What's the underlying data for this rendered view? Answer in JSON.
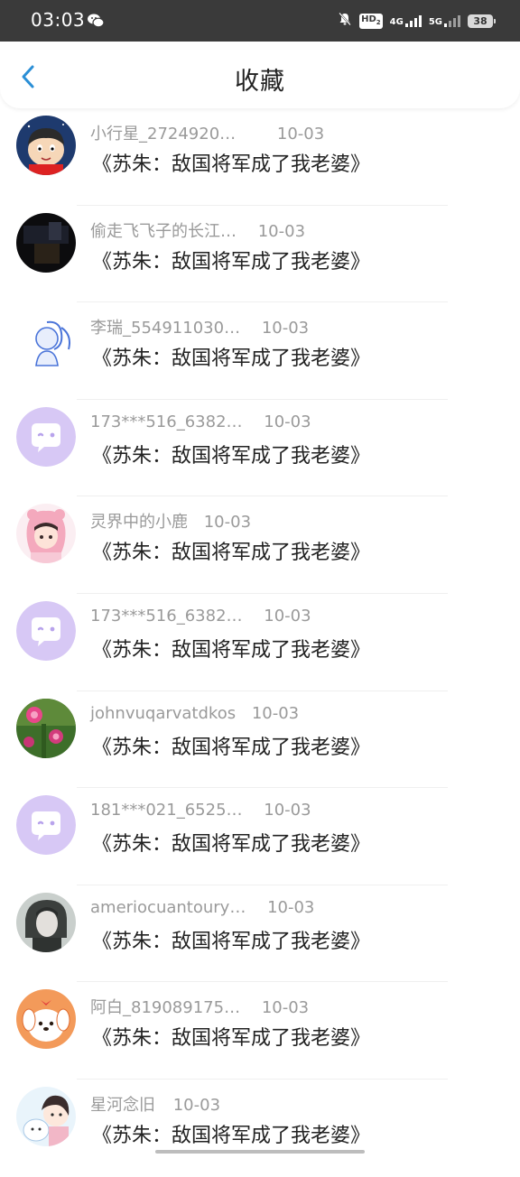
{
  "status_bar": {
    "time": "03:03",
    "battery": "38",
    "net_4g": "4G",
    "net_5g": "5G",
    "hd_label": "HD",
    "hd_sub": "2"
  },
  "header": {
    "title": "收藏",
    "back_icon": "chevron-left-icon",
    "accent": "#2b8fd6"
  },
  "items": [
    {
      "name": "小行星_2724920…",
      "date": "10-03",
      "book": "《苏朱：敌国将军成了我老婆》",
      "avatar": "cartoon-boy"
    },
    {
      "name": "偷走飞飞子的长江…",
      "date": "10-03",
      "book": "《苏朱：敌国将军成了我老婆》",
      "avatar": "dark-photo"
    },
    {
      "name": "李瑞_554911030…",
      "date": "10-03",
      "book": "《苏朱：敌国将军成了我老婆》",
      "avatar": "sketch-girl"
    },
    {
      "name": "173***516_6382…",
      "date": "10-03",
      "book": "《苏朱：敌国将军成了我老婆》",
      "avatar": "default-chat"
    },
    {
      "name": "灵界中的小鹿",
      "date": "10-03",
      "book": "《苏朱：敌国将军成了我老婆》",
      "avatar": "pink-girl"
    },
    {
      "name": "173***516_6382…",
      "date": "10-03",
      "book": "《苏朱：敌国将军成了我老婆》",
      "avatar": "default-chat"
    },
    {
      "name": "johnvuqarvatdkos",
      "date": "10-03",
      "book": "《苏朱：敌国将军成了我老婆》",
      "avatar": "flowers"
    },
    {
      "name": "181***021_6525…",
      "date": "10-03",
      "book": "《苏朱：敌国将军成了我老婆》",
      "avatar": "default-chat"
    },
    {
      "name": "ameriocuantoury…",
      "date": "10-03",
      "book": "《苏朱：敌国将军成了我老婆》",
      "avatar": "grey-portrait"
    },
    {
      "name": "阿白_819089175…",
      "date": "10-03",
      "book": "《苏朱：敌国将军成了我老婆》",
      "avatar": "dog-cartoon"
    },
    {
      "name": "星河念旧",
      "date": "10-03",
      "book": "《苏朱：敌国将军成了我老婆》",
      "avatar": "anime-girl"
    }
  ]
}
